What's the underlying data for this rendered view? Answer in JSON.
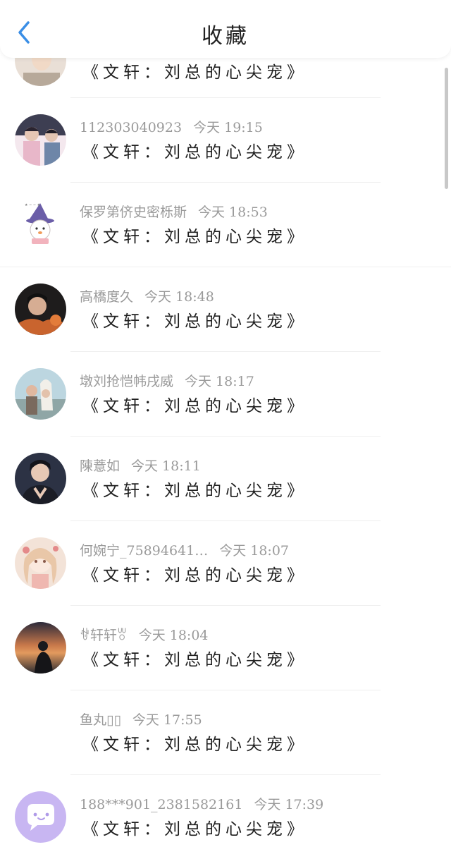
{
  "header": {
    "title": "收藏",
    "back_icon": "chevron-left-icon",
    "accent": "#3a8ee6"
  },
  "items": [
    {
      "avatar": "photo-avatar",
      "name": "",
      "time": "",
      "message": "《文轩：刘总的心尖宠》"
    },
    {
      "avatar": "photo-avatar",
      "name": "112303040923",
      "time": "今天 19:15",
      "message": "《文轩：刘总的心尖宠》"
    },
    {
      "avatar": "cartoon-avatar",
      "name": "保罗第侪史密栎斯",
      "time": "今天 18:53",
      "message": "《文轩：刘总的心尖宠》"
    },
    {
      "avatar": "photo-avatar",
      "name": "高橋度久",
      "time": "今天 18:48",
      "message": "《文轩：刘总的心尖宠》"
    },
    {
      "avatar": "photo-avatar",
      "name": "墩刘抢恺帏戌威",
      "time": "今天 18:17",
      "message": "《文轩：刘总的心尖宠》"
    },
    {
      "avatar": "photo-avatar",
      "name": "陳薏如",
      "time": "今天 18:11",
      "message": "《文轩：刘总的心尖宠》"
    },
    {
      "avatar": "illustration-avatar",
      "name": "何婉宁_75894641…",
      "time": "今天 18:07",
      "message": "《文轩：刘总的心尖宠》"
    },
    {
      "avatar": "sunset-avatar",
      "name": "ꊀ轩轩ꉕ",
      "time": "今天 18:04",
      "message": "《文轩：刘总的心尖宠》"
    },
    {
      "avatar": "none",
      "name": "鱼丸▯▯",
      "time": "今天 17:55",
      "message": "《文轩：刘总的心尖宠》"
    },
    {
      "avatar": "chat-bubble-icon",
      "name": "188***901_2381582161",
      "time": "今天 17:39",
      "message": "《文轩：刘总的心尖宠》"
    }
  ]
}
